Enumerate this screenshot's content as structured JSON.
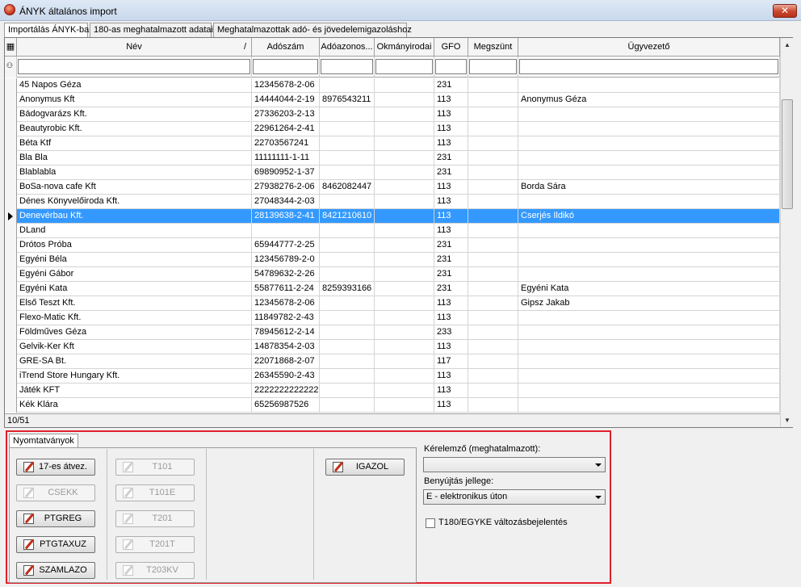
{
  "window": {
    "title": "ÁNYK általános import",
    "close_label": "✕"
  },
  "tabs": [
    "Importálás ÁNYK-ba",
    "180-as meghatalmazott adatai",
    "Meghatalmazottak adó- és jövedelemigazoláshoz"
  ],
  "grid": {
    "columns": [
      "Név",
      "Adószám",
      "Adóazonos...",
      "Okmányirodai",
      "GFO",
      "Megszünt",
      "Ügyvezető"
    ],
    "sort_indicator": "/",
    "rows": [
      [
        "45 Napos Géza",
        "12345678-2-06",
        "",
        "",
        "231",
        "",
        ""
      ],
      [
        "Anonymus Kft",
        "14444044-2-19",
        "8976543211",
        "",
        "113",
        "",
        "Anonymus Géza"
      ],
      [
        "Bádogvarázs Kft.",
        "27336203-2-13",
        "",
        "",
        "113",
        "",
        ""
      ],
      [
        "Beautyrobic Kft.",
        "22961264-2-41",
        "",
        "",
        "113",
        "",
        ""
      ],
      [
        "Béta Ktf",
        "22703567241",
        "",
        "",
        "113",
        "",
        ""
      ],
      [
        "Bla Bla",
        "11111111-1-11",
        "",
        "",
        "231",
        "",
        ""
      ],
      [
        "Blablabla",
        "69890952-1-37",
        "",
        "",
        "231",
        "",
        ""
      ],
      [
        "BoSa-nova cafe Kft",
        "27938276-2-06",
        "8462082447",
        "",
        "113",
        "",
        "Borda Sára"
      ],
      [
        "Dénes Könyvelőiroda Kft.",
        "27048344-2-03",
        "",
        "",
        "113",
        "",
        ""
      ],
      [
        "Denevérbau Kft.",
        "28139638-2-41",
        "8421210610",
        "",
        "113",
        "",
        "Cserjés Ildikó"
      ],
      [
        "DLand",
        "",
        "",
        "",
        "113",
        "",
        ""
      ],
      [
        "Drótos Próba",
        "65944777-2-25",
        "",
        "",
        "231",
        "",
        ""
      ],
      [
        "Egyéni Béla",
        "123456789-2-0",
        "",
        "",
        "231",
        "",
        ""
      ],
      [
        "Egyéni Gábor",
        "54789632-2-26",
        "",
        "",
        "231",
        "",
        ""
      ],
      [
        "Egyéni Kata",
        "55877611-2-24",
        "8259393166",
        "",
        "231",
        "",
        "Egyéni Kata"
      ],
      [
        "Első Teszt Kft.",
        "12345678-2-06",
        "",
        "",
        "113",
        "",
        "Gipsz Jakab"
      ],
      [
        "Flexo-Matic Kft.",
        "11849782-2-43",
        "",
        "",
        "113",
        "",
        ""
      ],
      [
        "Földműves Géza",
        "78945612-2-14",
        "",
        "",
        "233",
        "",
        ""
      ],
      [
        "Gelvik-Ker Kft",
        "14878354-2-03",
        "",
        "",
        "113",
        "",
        ""
      ],
      [
        "GRE-SA Bt.",
        "22071868-2-07",
        "",
        "",
        "117",
        "",
        ""
      ],
      [
        "iTrend Store Hungary Kft.",
        "26345590-2-43",
        "",
        "",
        "113",
        "",
        ""
      ],
      [
        "Játék KFT",
        "2222222222222",
        "",
        "",
        "113",
        "",
        ""
      ],
      [
        "Kék Klára",
        "65256987526",
        "",
        "",
        "113",
        "",
        ""
      ]
    ],
    "selected_row": 9,
    "status": "10/51"
  },
  "bottom": {
    "tab": "Nyomtatványok",
    "buttons_col1": [
      "17-es átvez.",
      "CSEKK",
      "PTGREG",
      "PTGTAXUZ",
      "SZAMLAZO"
    ],
    "buttons_col2": [
      "T101",
      "T101E",
      "T201",
      "T201T",
      "T203KV"
    ],
    "igazol": "IGAZOL",
    "kerelmezo_label": "Kérelemző (meghatalmazott):",
    "kerelmezo_value": "",
    "benyujtas_label": "Benyújtás jellege:",
    "benyujtas_value": "E - elektronikus úton",
    "checkbox_label": "T180/EGYKE változásbejelentés"
  },
  "colors": {
    "selection": "#3399ff",
    "highlight_border": "#e0202a"
  }
}
